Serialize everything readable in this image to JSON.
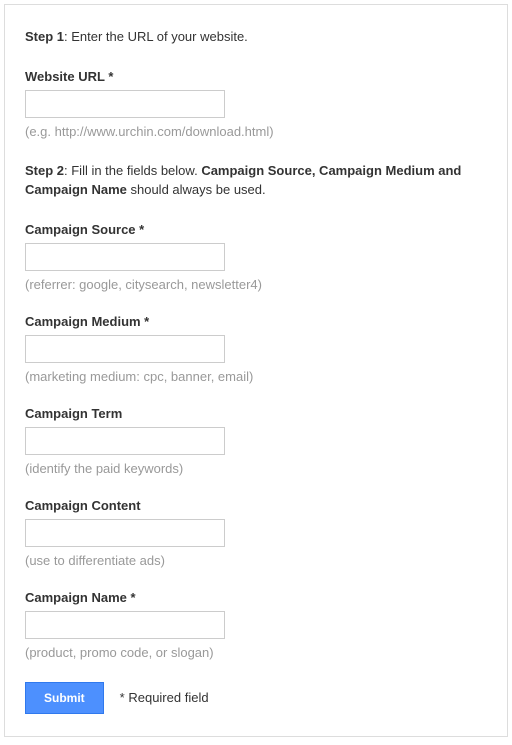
{
  "step1": {
    "label": "Step 1",
    "text": ": Enter the URL of your website."
  },
  "website_url": {
    "label": "Website URL *",
    "hint": "(e.g. http://www.urchin.com/download.html)"
  },
  "step2": {
    "label": "Step 2",
    "text_before": ": Fill in the fields below. ",
    "emphasis": "Campaign Source, Campaign Medium and Campaign Name",
    "text_after": " should always be used."
  },
  "campaign_source": {
    "label": "Campaign Source *",
    "hint": "(referrer: google, citysearch, newsletter4)"
  },
  "campaign_medium": {
    "label": "Campaign Medium *",
    "hint": "(marketing medium: cpc, banner, email)"
  },
  "campaign_term": {
    "label": "Campaign Term",
    "hint": "(identify the paid keywords)"
  },
  "campaign_content": {
    "label": "Campaign Content",
    "hint": "(use to differentiate ads)"
  },
  "campaign_name": {
    "label": "Campaign Name *",
    "hint": "(product, promo code, or slogan)"
  },
  "submit_label": "Submit",
  "required_note": "* Required field"
}
